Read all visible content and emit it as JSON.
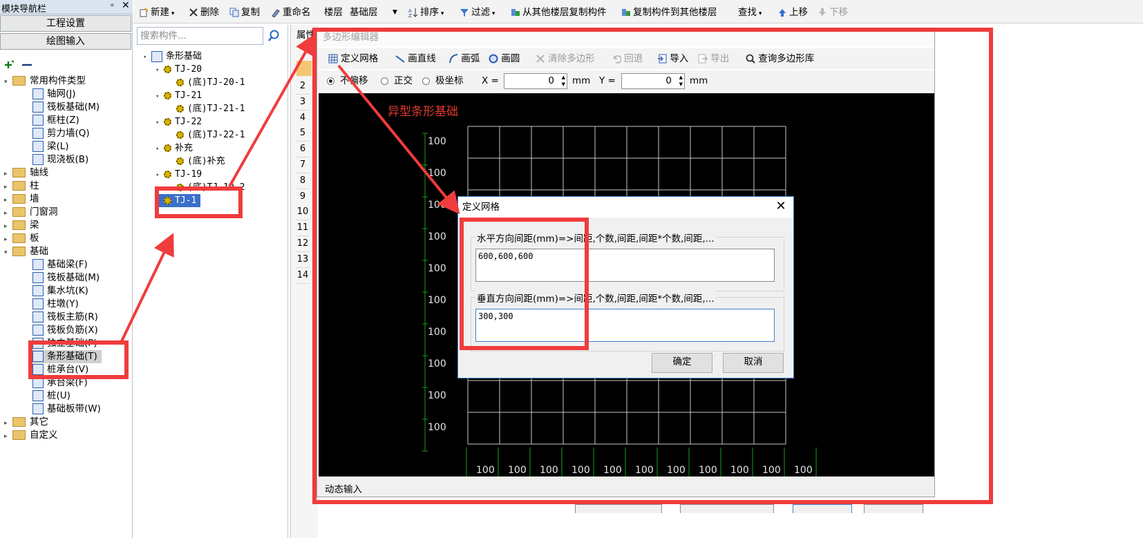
{
  "nav": {
    "title": "模块导航栏",
    "pin_glyph": "ᵒ",
    "close_glyph": "✕",
    "btn_project": "工程设置",
    "btn_drawing": "绘图输入",
    "tree": [
      {
        "label": "常用构件类型",
        "type": "folder",
        "open": true
      },
      {
        "label": "轴网(J)",
        "type": "item"
      },
      {
        "label": "筏板基础(M)",
        "type": "item"
      },
      {
        "label": "框柱(Z)",
        "type": "item"
      },
      {
        "label": "剪力墙(Q)",
        "type": "item"
      },
      {
        "label": "梁(L)",
        "type": "item"
      },
      {
        "label": "现浇板(B)",
        "type": "item"
      },
      {
        "label": "轴线",
        "type": "folder"
      },
      {
        "label": "柱",
        "type": "folder"
      },
      {
        "label": "墙",
        "type": "folder"
      },
      {
        "label": "门窗洞",
        "type": "folder"
      },
      {
        "label": "梁",
        "type": "folder"
      },
      {
        "label": "板",
        "type": "folder"
      },
      {
        "label": "基础",
        "type": "folder",
        "open": true
      },
      {
        "label": "基础梁(F)",
        "type": "item"
      },
      {
        "label": "筏板基础(M)",
        "type": "item"
      },
      {
        "label": "集水坑(K)",
        "type": "item"
      },
      {
        "label": "柱墩(Y)",
        "type": "item"
      },
      {
        "label": "筏板主筋(R)",
        "type": "item"
      },
      {
        "label": "筏板负筋(X)",
        "type": "item"
      },
      {
        "label": "独立基础(P)",
        "type": "item"
      },
      {
        "label": "条形基础(T)",
        "type": "item",
        "selected": true
      },
      {
        "label": "桩承台(V)",
        "type": "item"
      },
      {
        "label": "承台梁(F)",
        "type": "item"
      },
      {
        "label": "桩(U)",
        "type": "item"
      },
      {
        "label": "基础板带(W)",
        "type": "item"
      },
      {
        "label": "其它",
        "type": "folder"
      },
      {
        "label": "自定义",
        "type": "folder"
      }
    ]
  },
  "toolbar": {
    "new": "新建",
    "delete": "删除",
    "copy": "复制",
    "rename": "重命名",
    "floor_label": "楼层",
    "floor_value": "基础层",
    "sort": "排序",
    "filter": "过滤",
    "copy_from_floor": "从其他楼层复制构件",
    "copy_to_floor": "复制构件到其他楼层",
    "find": "查找",
    "move_up": "上移",
    "move_down": "下移"
  },
  "components": {
    "search_placeholder": "搜索构件...",
    "tree": [
      {
        "label": "条形基础",
        "level": 0
      },
      {
        "label": "TJ-20",
        "level": 1
      },
      {
        "label": "(底)TJ-20-1",
        "level": 2
      },
      {
        "label": "TJ-21",
        "level": 1
      },
      {
        "label": "(底)TJ-21-1",
        "level": 2
      },
      {
        "label": "TJ-22",
        "level": 1
      },
      {
        "label": "(底)TJ-22-1",
        "level": 2
      },
      {
        "label": "补充",
        "level": 1
      },
      {
        "label": "(底)补充",
        "level": 2
      },
      {
        "label": "TJ-19",
        "level": 1
      },
      {
        "label": "(底)TJ-19-2",
        "level": 2
      },
      {
        "label": "TJ-1",
        "level": 1,
        "selected": true
      }
    ]
  },
  "property": {
    "tab": "属性",
    "rows": [
      "2",
      "3",
      "4",
      "5",
      "6",
      "7",
      "8",
      "9",
      "10",
      "11",
      "12",
      "13",
      "14"
    ]
  },
  "editor": {
    "title": "多边形编辑器",
    "tb1": {
      "define_grid": "定义网格",
      "draw_line": "画直线",
      "draw_arc": "画弧",
      "draw_circle": "画圆",
      "clear_polygon": "清除多边形",
      "undo": "回退",
      "import": "导入",
      "export": "导出",
      "query_lib": "查询多边形库"
    },
    "tb2": {
      "no_offset": "不偏移",
      "ortho": "正交",
      "polar": "极坐标",
      "x_label": "X =",
      "x_value": "0",
      "x_unit": "mm",
      "y_label": "Y =",
      "y_value": "0",
      "y_unit": "mm"
    },
    "canvas_title": "异型条形基础",
    "grid": {
      "rows": 10,
      "cols": 10,
      "row_labels": [
        "100",
        "100",
        "100",
        "100",
        "100",
        "100",
        "100",
        "100",
        "100",
        "100"
      ],
      "col_labels": [
        "100",
        "100",
        "100",
        "100",
        "100",
        "100",
        "100",
        "100",
        "100",
        "100",
        "100"
      ]
    },
    "status": "动态输入"
  },
  "dialog": {
    "title": "定义网格",
    "close_glyph": "✕",
    "h_label": "水平方向间距(mm)=>间距,个数,间距,间距*个数,间距,...",
    "h_value": "600,600,600",
    "v_label": "垂直方向间距(mm)=>间距,个数,间距,间距*个数,间距,...",
    "v_value": "300,300",
    "ok": "确定",
    "cancel": "取消"
  },
  "colors": {
    "annotation_red": "#f03c3c",
    "canvas_title_red": "#e23b2e",
    "grid_line": "#c8c8c8",
    "axis_green": "#19a019",
    "select_blue": "#3b6fc9"
  }
}
